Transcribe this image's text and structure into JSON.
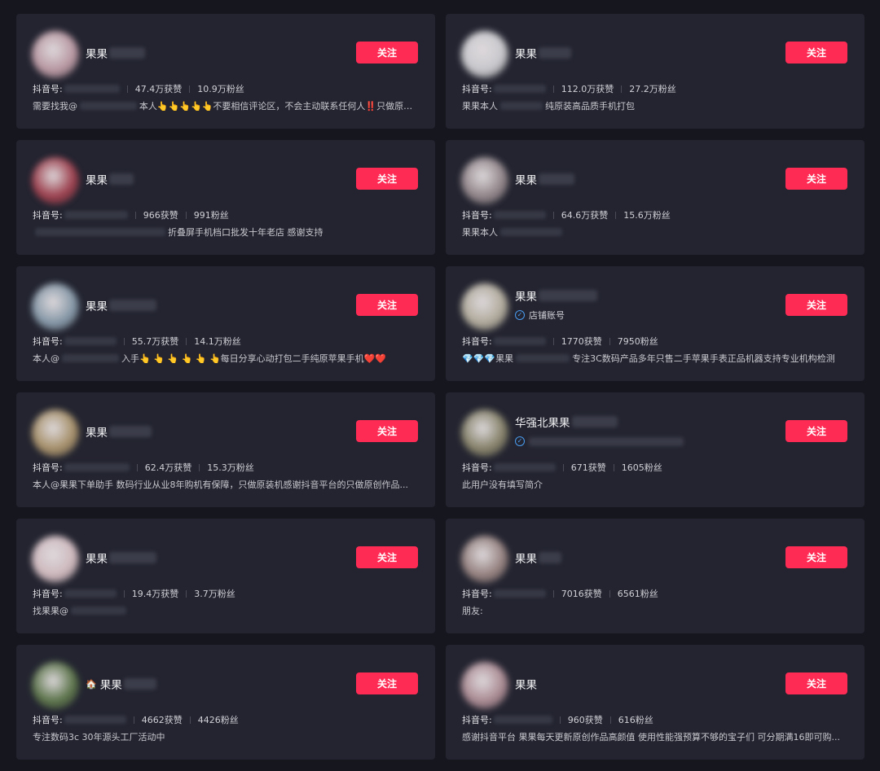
{
  "labels": {
    "follow": "关注",
    "douyin_id": "抖音号:"
  },
  "colors": {
    "page_bg": "#15161e",
    "card_bg": "#232430",
    "follow_bg": "#fe2c55",
    "verified_blue": "#4a9df0"
  },
  "cards": [
    {
      "name": "果果",
      "likes": "47.4万获赞",
      "fans": "10.9万粉丝",
      "bio_before": "需要找我@",
      "bio_after": "本人👆👆👆👆👆不要相信评论区，不会主动联系任何人‼️只做原装...",
      "avatar_color": "#c8a3ad"
    },
    {
      "name": "果果",
      "likes": "112.0万获赞",
      "fans": "27.2万粉丝",
      "bio_before": "果果本人",
      "bio_after": "纯原装高品质手机打包",
      "avatar_color": "#d9d9dc"
    },
    {
      "name": "果果",
      "likes": "966获赞",
      "fans": "991粉丝",
      "bio_before": "",
      "bio_after": "折叠屏手机档口批发十年老店 感谢支持",
      "avatar_color": "#a8404e"
    },
    {
      "name": "果果",
      "likes": "64.6万获赞",
      "fans": "15.6万粉丝",
      "bio_before": "果果本人",
      "bio_after": "",
      "avatar_color": "#9c8f92"
    },
    {
      "name": "果果",
      "likes": "55.7万获赞",
      "fans": "14.1万粉丝",
      "bio_before": "本人@",
      "bio_after": "入手👆 👆 👆 👆 👆 👆每日分享心动打包二手纯原苹果手机❤️❤️",
      "avatar_color": "#8fa3b3"
    },
    {
      "name": "果果",
      "sub_label": "店铺账号",
      "likes": "1770获赞",
      "fans": "7950粉丝",
      "bio_before": "💎💎💎果果",
      "bio_after": "专注3C数码产品多年只售二手苹果手表正品机器支持专业机构检测",
      "avatar_color": "#bfb8a6"
    },
    {
      "name": "果果",
      "likes": "62.4万获赞",
      "fans": "15.3万粉丝",
      "bio_before": "",
      "bio_after": "本人@果果下单助手 数码行业从业8年购机有保障，只做原装机感谢抖音平台的只做原创作品...",
      "avatar_color": "#b39a6e"
    },
    {
      "name": "华强北果果",
      "likes": "671获赞",
      "fans": "1605粉丝",
      "bio_before": "",
      "bio_after": "此用户没有填写简介",
      "avatar_color": "#8f8a6e"
    },
    {
      "name": "果果",
      "likes": "19.4万获赞",
      "fans": "3.7万粉丝",
      "bio_before": "找果果@",
      "bio_after": "",
      "avatar_color": "#e0c8cc"
    },
    {
      "name": "果果",
      "likes": "7016获赞",
      "fans": "6561粉丝",
      "bio_before": "",
      "bio_after": "朋友:",
      "avatar_color": "#a08a86"
    },
    {
      "name": "果果",
      "name_prefix": "🏠",
      "likes": "4662获赞",
      "fans": "4426粉丝",
      "bio_before": "",
      "bio_after": "专注数码3c 30年源头工厂活动中",
      "avatar_color": "#5f7a4a"
    },
    {
      "name": "果果",
      "likes": "960获赞",
      "fans": "616粉丝",
      "bio_before": "",
      "bio_after": "感谢抖音平台 果果每天更新原创作品高颜值 使用性能强预算不够的宝子们 可分期满16即可购...",
      "avatar_color": "#b8949c"
    }
  ]
}
